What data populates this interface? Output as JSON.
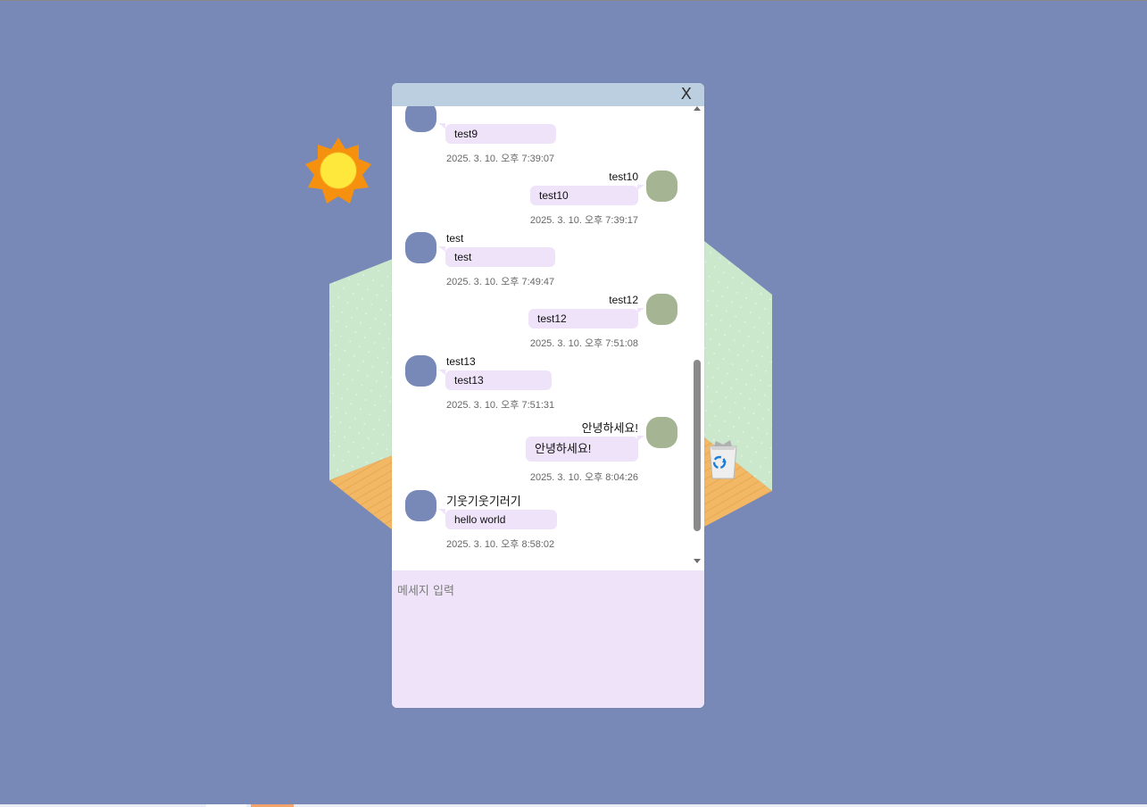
{
  "chat": {
    "close_label": "X",
    "input_placeholder": "메세지 입력",
    "messages": [
      {
        "sender": "",
        "text": "test9",
        "time": "2025. 3. 10. 오후 7:39:07",
        "side": "left"
      },
      {
        "sender": "test10",
        "text": "test10",
        "time": "2025. 3. 10. 오후 7:39:17",
        "side": "right"
      },
      {
        "sender": "test",
        "text": "test",
        "time": "2025. 3. 10. 오후 7:49:47",
        "side": "left"
      },
      {
        "sender": "test12",
        "text": "test12",
        "time": "2025. 3. 10. 오후 7:51:08",
        "side": "right"
      },
      {
        "sender": "test13",
        "text": "test13",
        "time": "2025. 3. 10. 오후 7:51:31",
        "side": "left"
      },
      {
        "sender": "안녕하세요!",
        "text": "안녕하세요!",
        "time": "2025. 3. 10. 오후 8:04:26",
        "side": "right"
      },
      {
        "sender": "기웃기웃기러기",
        "text": "hello world",
        "time": "2025. 3. 10. 오후 8:58:02",
        "side": "left"
      }
    ]
  },
  "scene": {
    "icons": [
      "sun-icon",
      "recycle-bin-icon"
    ]
  },
  "colors": {
    "background": "#7889b8",
    "header": "#bccfe0",
    "bubble": "#efe3fa",
    "avatar_other": "#7889b8",
    "avatar_me": "#a5b493",
    "wall": "#cbe8cc",
    "floor": "#f2b866"
  }
}
